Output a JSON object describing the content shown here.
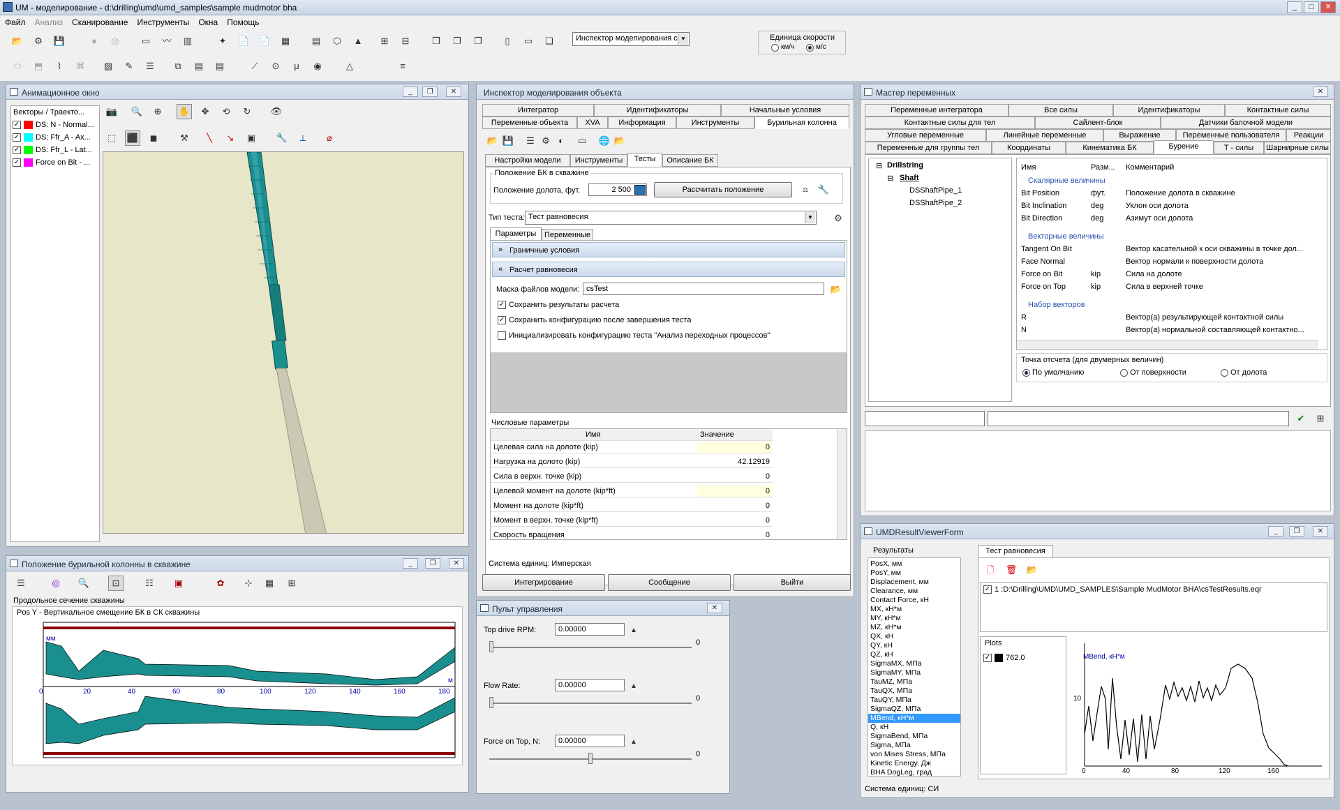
{
  "app": {
    "title": "UM - моделирование - d:\\drilling\\umd\\umd_samples\\sample mudmotor bha"
  },
  "menu": [
    "Файл",
    "Анализ",
    "Сканирование",
    "Инструменты",
    "Окна",
    "Помощь"
  ],
  "toolbar": {
    "inspector_combo": "Инспектор моделирования с",
    "speed_group": "Единица скорости",
    "speed_opt1": "км/ч",
    "speed_opt2": "м/с"
  },
  "anim": {
    "title": "Анимационное окно",
    "vectors_header": "Векторы / Траекто...",
    "vectors": [
      {
        "label": "DS: N - Normal...",
        "color": "#ff0000"
      },
      {
        "label": "DS: Ffr_A - Ax...",
        "color": "#00ffff"
      },
      {
        "label": "DS: Ffr_L - Lat...",
        "color": "#00ff00"
      },
      {
        "label": "Force on Bit - ...",
        "color": "#ff00ff"
      }
    ]
  },
  "pos": {
    "title": "Положение бурильной колонны в скважине",
    "section": "Продольное сечение скважины",
    "subtitle": "Pos Y - Вертикальное смещение БК в СК скважины",
    "unit_left": "мм",
    "unit_right": "м",
    "xticks": [
      "0",
      "20",
      "40",
      "60",
      "80",
      "100",
      "120",
      "140",
      "160",
      "180"
    ]
  },
  "inspector": {
    "title": "Инспектор моделирования объекта",
    "tabs_row1": [
      "Интегратор",
      "Идентификаторы",
      "Начальные условия"
    ],
    "tabs_row2": [
      "Переменные объекта",
      "XVA",
      "Информация",
      "Инструменты",
      "Бурильная колонна"
    ],
    "subtabs": [
      "Настройки модели",
      "Инструменты",
      "Тесты",
      "Описание БК"
    ],
    "group_pos": "Положение БК в скважине",
    "bit_pos_label": "Положение долота, фут.",
    "bit_pos_value": "2 500",
    "calc_button": "Рассчитать положение",
    "test_type_label": "Тип теста:",
    "test_type_value": "Тест равновесия",
    "ptabs": [
      "Параметры",
      "Переменные"
    ],
    "sec1": "Граничные условия",
    "sec2": "Расчет равновесия",
    "mask_label": "Маска файлов модели:",
    "mask_value": "csTest",
    "chk1": "Сохранить результаты расчета",
    "chk2": "Сохранить конфигурацию после завершения теста",
    "chk3": "Инициализировать конфигурацию теста \"Анализ переходных процессов\"",
    "num_title": "Числовые параметры",
    "col_name": "Имя",
    "col_value": "Значение",
    "rows": [
      {
        "name": "Целевая сила на долоте (kip)",
        "value": "0"
      },
      {
        "name": "Нагрузка на долото (kip)",
        "value": "42.12919"
      },
      {
        "name": "Сила в верхн. точке (kip)",
        "value": "0"
      },
      {
        "name": "Целевой момент на долоте (kip*ft)",
        "value": "0"
      },
      {
        "name": "Момент на долоте (kip*ft)",
        "value": "0"
      },
      {
        "name": "Момент в верхн. точке (kip*ft)",
        "value": "0"
      },
      {
        "name": "Скорость вращения",
        "value": "0"
      }
    ],
    "units": "Система единиц: Имперская",
    "btn_integrate": "Интегрирование",
    "btn_message": "Сообщение",
    "btn_exit": "Выйти"
  },
  "control": {
    "title": "Пульт управления",
    "items": [
      {
        "label": "Top drive RPM:",
        "value": "0.00000",
        "max": "0"
      },
      {
        "label": "Flow Rate:",
        "value": "0.00000",
        "max": "0"
      },
      {
        "label": "Force on Top, N:",
        "value": "0.00000",
        "max": "0"
      }
    ]
  },
  "vars": {
    "title": "Мастер переменных",
    "tabs_r1": [
      "Переменные интегратора",
      "Все силы",
      "Идентификаторы",
      "Контактные силы"
    ],
    "tabs_r2": [
      "Контактные силы для тел",
      "Сайлент-блок",
      "Датчики балочной модели"
    ],
    "tabs_r3": [
      "Угловые переменные",
      "Линейные переменные",
      "Выражение",
      "Переменные пользователя",
      "Реакции"
    ],
    "tabs_r4": [
      "Переменные для группы тел",
      "Координаты",
      "Кинематика БК",
      "Бурение",
      "T - силы",
      "Шарнирные силы"
    ],
    "tree": [
      "Drillstring",
      "Shaft",
      "DSShaftPipe_1",
      "DSShaftPipe_2"
    ],
    "col_name": "Имя",
    "col_dim": "Разм...",
    "col_comment": "Комментарий",
    "scalar": "Скалярные величины",
    "vector": "Векторные величины",
    "vset": "Набор векторов",
    "rows_s": [
      {
        "n": "Bit Position",
        "d": "фут.",
        "c": "Положение долота в скважине"
      },
      {
        "n": "Bit Inclination",
        "d": "deg",
        "c": "Уклон оси долота"
      },
      {
        "n": "Bit Direction",
        "d": "deg",
        "c": "Азимут оси долота"
      }
    ],
    "rows_v": [
      {
        "n": "Tangent On Bit",
        "d": "",
        "c": "Вектор касательной к оси скважины в точке дол..."
      },
      {
        "n": "Face Normal",
        "d": "",
        "c": "Вектор нормали к поверхности долота"
      },
      {
        "n": "Force on Bit",
        "d": "kip",
        "c": "Сила на долоте"
      },
      {
        "n": "Force on Top",
        "d": "kip",
        "c": "Сила в верхней точке"
      }
    ],
    "rows_set": [
      {
        "n": "R",
        "d": "",
        "c": "Вектор(а) результирующей контактной силы"
      },
      {
        "n": "N",
        "d": "",
        "c": "Вектор(а) нормальной составляющей контактно..."
      }
    ],
    "ref_title": "Точка отсчета (для двумерных величин)",
    "ref1": "По умолчанию",
    "ref2": "От поверхности",
    "ref3": "От долота"
  },
  "result": {
    "title": "UMDResultViewerForm",
    "results_label": "Результаты",
    "test_tab": "Тест равновесия",
    "list": [
      "PosX, мм",
      "PosY, мм",
      "Displacement, мм",
      "Clearance, мм",
      "Contact Force, кН",
      "MX, кН*м",
      "MY, кН*м",
      "MZ, кН*м",
      "QX, кН",
      "QY, кН",
      "QZ, кН",
      "SigmaMX, МПа",
      "SigmaMY, МПа",
      "TauMZ, МПа",
      "TauQX, МПа",
      "TauQY, МПа",
      "SigmaQZ, МПа",
      "MBend, кН*м",
      "Q, кН",
      "SigmaBend, МПа",
      "Sigma, МПа",
      "von Mises Stress, МПа",
      "Kinetic Energy, Дж",
      "BHA DogLeg, град"
    ],
    "selected": "MBend, кН*м",
    "file": "1 :D:\\Drilling\\UMD\\UMD_SAMPLES\\Sample MudMotor BHA\\csTestResults.eqr",
    "plots_label": "Plots",
    "plot_item": "762.0",
    "plot_color": "#000000",
    "chart_ylabel": "MBend, кН*м",
    "chart_ytick": "10",
    "chart_xticks": [
      "0",
      "40",
      "80",
      "120",
      "160"
    ],
    "units": "Система единиц: СИ"
  }
}
